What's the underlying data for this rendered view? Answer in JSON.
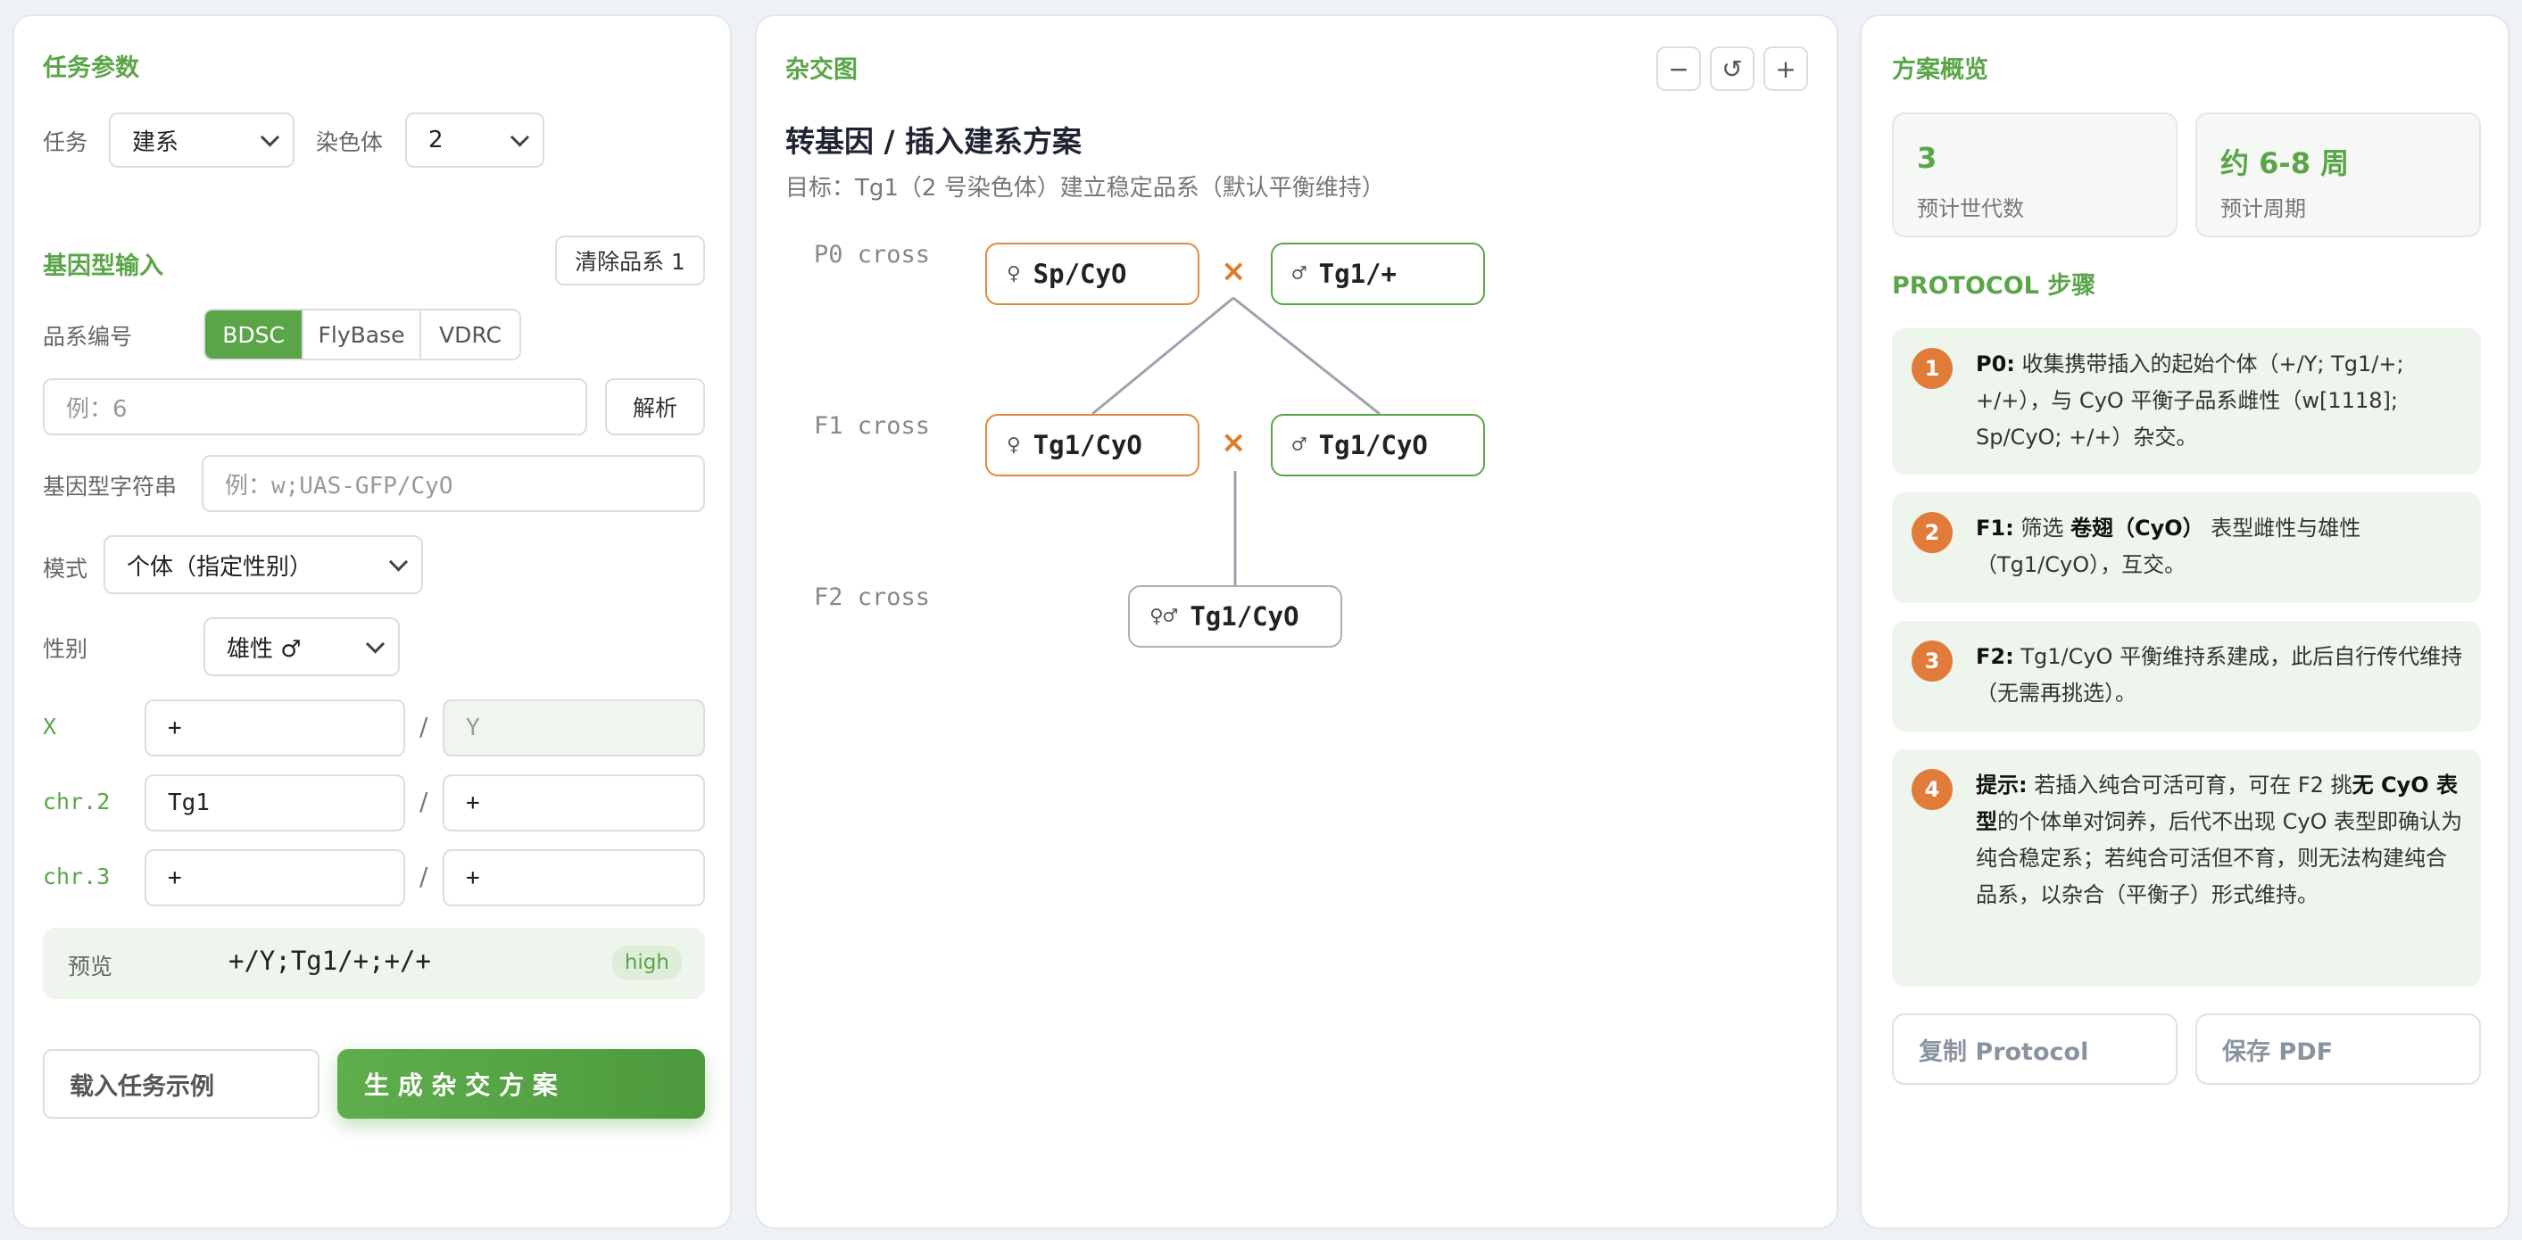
{
  "left": {
    "task_params_title": "任务参数",
    "task_label": "任务",
    "task_value": "建系",
    "chromosome_label": "染色体",
    "chromosome_value": "2",
    "genotype_input_title": "基因型输入",
    "clear_button": "清除品系 1",
    "stock_id_label": "品系编号",
    "stock_sources": [
      "BDSC",
      "FlyBase",
      "VDRC"
    ],
    "stock_input_placeholder": "例：6",
    "parse_button": "解析",
    "genotype_string_label": "基因型字符串",
    "genotype_string_placeholder": "例：w;UAS-GFP/CyO",
    "mode_label": "模式",
    "mode_value": "个体（指定性别）",
    "sex_label": "性别",
    "sex_value": "雄性 ♂",
    "chromosomes": [
      {
        "label": "X",
        "left": "+",
        "right": "Y",
        "right_readonly": true
      },
      {
        "label": "chr.2",
        "left": "Tg1",
        "right": "+"
      },
      {
        "label": "chr.3",
        "left": "+",
        "right": "+"
      }
    ],
    "slash": "/",
    "preview_label": "预览",
    "preview_value": "+/Y;Tg1/+;+/+",
    "preview_badge": "high",
    "load_example_button": "载入任务示例",
    "generate_button": "生 成 杂 交 方 案"
  },
  "middle": {
    "title": "杂交图",
    "zoom_out": "−",
    "zoom_reset": "↺",
    "zoom_in": "+",
    "scheme_title": "转基因 / 插入建系方案",
    "scheme_subtitle": "目标：Tg1（2 号染色体）建立稳定品系（默认平衡维持）",
    "generations": [
      "P0 cross",
      "F1 cross",
      "F2 cross"
    ],
    "cross_symbol": "×",
    "nodes": {
      "p0_female": {
        "sym": "♀",
        "label": "Sp/CyO"
      },
      "p0_male": {
        "sym": "♂",
        "label": "Tg1/+"
      },
      "f1_female": {
        "sym": "♀",
        "label": "Tg1/CyO"
      },
      "f1_male": {
        "sym": "♂",
        "label": "Tg1/CyO"
      },
      "f2": {
        "sym": "♀♂",
        "label": "Tg1/CyO"
      }
    }
  },
  "right": {
    "overview_title": "方案概览",
    "generations_value": "3",
    "generations_label": "预计世代数",
    "period_value": "约 6-8 周",
    "period_label": "预计周期",
    "protocol_title": "PROTOCOL 步骤",
    "steps": [
      {
        "num": "1",
        "head": "P0:",
        "text": "收集携带插入的起始个体（+/Y; Tg1/+; +/+），与 CyO 平衡子品系雌性（w[1118]; Sp/CyO; +/+）杂交。"
      },
      {
        "num": "2",
        "head": "F1:",
        "pre": "筛选 ",
        "bold": "卷翅（CyO）",
        "text": " 表型雌性与雄性（Tg1/CyO），互交。"
      },
      {
        "num": "3",
        "head": "F2:",
        "text": "Tg1/CyO 平衡维持系建成，此后自行传代维持（无需再挑选）。"
      },
      {
        "num": "4",
        "head": "提示:",
        "pre": "若插入纯合可活可育，可在 F2 挑",
        "bold": "无 CyO 表型",
        "text": "的个体单对饲养，后代不出现 CyO 表型即确认为纯合稳定系；若纯合可活但不育，则无法构建纯合品系，以杂合（平衡子）形式维持。"
      }
    ],
    "copy_button": "复制 Protocol",
    "save_button": "保存 PDF"
  },
  "colors": {
    "accent_green": "#5aa548",
    "female_orange": "#e08a3c",
    "step_number": "#e07b3a"
  }
}
